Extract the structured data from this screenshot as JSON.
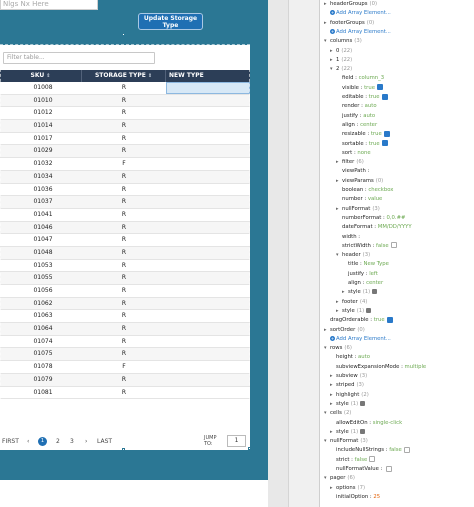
{
  "canvas": {
    "top_search_placeholder": "Nlgs Nx Here",
    "update_button_label": "Update Storage Type",
    "filter_placeholder": "Filter table...",
    "columns": [
      "SKU",
      "STORAGE TYPE",
      "NEW TYPE"
    ],
    "rows": [
      {
        "sku": "01008",
        "storage": "R"
      },
      {
        "sku": "01010",
        "storage": "R"
      },
      {
        "sku": "01012",
        "storage": "R"
      },
      {
        "sku": "01014",
        "storage": "R"
      },
      {
        "sku": "01017",
        "storage": "R"
      },
      {
        "sku": "01029",
        "storage": "R"
      },
      {
        "sku": "01032",
        "storage": "F"
      },
      {
        "sku": "01034",
        "storage": "R"
      },
      {
        "sku": "01036",
        "storage": "R"
      },
      {
        "sku": "01037",
        "storage": "R"
      },
      {
        "sku": "01041",
        "storage": "R"
      },
      {
        "sku": "01046",
        "storage": "R"
      },
      {
        "sku": "01047",
        "storage": "R"
      },
      {
        "sku": "01048",
        "storage": "R"
      },
      {
        "sku": "01053",
        "storage": "R"
      },
      {
        "sku": "01055",
        "storage": "R"
      },
      {
        "sku": "01056",
        "storage": "R"
      },
      {
        "sku": "01062",
        "storage": "R"
      },
      {
        "sku": "01063",
        "storage": "R"
      },
      {
        "sku": "01064",
        "storage": "R"
      },
      {
        "sku": "01074",
        "storage": "R"
      },
      {
        "sku": "01075",
        "storage": "R"
      },
      {
        "sku": "01078",
        "storage": "F"
      },
      {
        "sku": "01079",
        "storage": "R"
      },
      {
        "sku": "01081",
        "storage": "R"
      }
    ],
    "pager": {
      "first": "FIRST",
      "prev": "‹",
      "pages": [
        "1",
        "2",
        "3"
      ],
      "next": "›",
      "last": "LAST",
      "jump_label": "JUMP TO:",
      "jump_value": "1"
    }
  },
  "props": {
    "add_array_label": "Add Array Element...",
    "items": [
      {
        "indent": 1,
        "caret": "▸",
        "key": "headerGroups",
        "badge": "(0)"
      },
      {
        "indent": 2,
        "type": "add"
      },
      {
        "indent": 1,
        "caret": "▸",
        "key": "footerGroups",
        "badge": "(0)"
      },
      {
        "indent": 2,
        "type": "add"
      },
      {
        "indent": 1,
        "caret": "▾",
        "key": "columns",
        "badge": "(3)"
      },
      {
        "indent": 2,
        "caret": "▸",
        "key": "0",
        "badge": "(22)"
      },
      {
        "indent": 2,
        "caret": "▸",
        "key": "1",
        "badge": "(22)"
      },
      {
        "indent": 2,
        "caret": "▾",
        "key": "2",
        "badge": "(22)"
      },
      {
        "indent": 3,
        "key": "field",
        "value": "column_3",
        "vtype": "str"
      },
      {
        "indent": 3,
        "key": "visible",
        "value": "true",
        "vtype": "bool",
        "check": true
      },
      {
        "indent": 3,
        "key": "editable",
        "value": "true",
        "vtype": "bool",
        "check": true
      },
      {
        "indent": 3,
        "key": "render",
        "value": "auto",
        "vtype": "str"
      },
      {
        "indent": 3,
        "key": "justify",
        "value": "auto",
        "vtype": "str"
      },
      {
        "indent": 3,
        "key": "align",
        "value": "center",
        "vtype": "str"
      },
      {
        "indent": 3,
        "key": "resizable",
        "value": "true",
        "vtype": "bool",
        "check": true
      },
      {
        "indent": 3,
        "key": "sortable",
        "value": "true",
        "vtype": "bool",
        "check": true
      },
      {
        "indent": 3,
        "key": "sort",
        "value": "none",
        "vtype": "str"
      },
      {
        "indent": 3,
        "caret": "▸",
        "key": "filter",
        "badge": "(6)"
      },
      {
        "indent": 3,
        "key": "viewPath",
        "value": "",
        "vtype": "str"
      },
      {
        "indent": 3,
        "caret": "▸",
        "key": "viewParams",
        "badge": "(0)"
      },
      {
        "indent": 3,
        "key": "boolean",
        "value": "checkbox",
        "vtype": "str"
      },
      {
        "indent": 3,
        "key": "number",
        "value": "value",
        "vtype": "str"
      },
      {
        "indent": 3,
        "caret": "▸",
        "key": "nullFormat",
        "badge": "(3)"
      },
      {
        "indent": 3,
        "key": "numberFormat",
        "value": "0,0.##",
        "vtype": "str"
      },
      {
        "indent": 3,
        "key": "dateFormat",
        "value": "MM/DD/YYYY",
        "vtype": "str"
      },
      {
        "indent": 3,
        "key": "width",
        "value": "",
        "vtype": "str"
      },
      {
        "indent": 3,
        "key": "strictWidth",
        "value": "false",
        "vtype": "bool",
        "check": false
      },
      {
        "indent": 3,
        "caret": "▾",
        "key": "header",
        "badge": "(3)"
      },
      {
        "indent": 4,
        "key": "title",
        "value": "New Type",
        "vtype": "str"
      },
      {
        "indent": 4,
        "key": "justify",
        "value": "left",
        "vtype": "str"
      },
      {
        "indent": 4,
        "key": "align",
        "value": "center",
        "vtype": "str"
      },
      {
        "indent": 4,
        "caret": "▸",
        "key": "style",
        "badge": "(1)",
        "bind": true
      },
      {
        "indent": 3,
        "caret": "▸",
        "key": "footer",
        "badge": "(4)"
      },
      {
        "indent": 3,
        "caret": "▸",
        "key": "style",
        "badge": "(1)",
        "bind": true
      },
      {
        "indent": 1,
        "key": "dragOrderable",
        "value": "true",
        "vtype": "bool",
        "check": true
      },
      {
        "indent": 1,
        "caret": "▸",
        "key": "sortOrder",
        "badge": "(0)"
      },
      {
        "indent": 2,
        "type": "add"
      },
      {
        "indent": 1,
        "caret": "▾",
        "key": "rows",
        "badge": "(6)"
      },
      {
        "indent": 2,
        "key": "height",
        "value": "auto",
        "vtype": "str"
      },
      {
        "indent": 2,
        "key": "subviewExpansionMode",
        "value": "multiple",
        "vtype": "str"
      },
      {
        "indent": 2,
        "caret": "▸",
        "key": "subview",
        "badge": "(3)"
      },
      {
        "indent": 2,
        "caret": "▸",
        "key": "striped",
        "badge": "(3)"
      },
      {
        "indent": 2,
        "caret": "▸",
        "key": "highlight",
        "badge": "(2)"
      },
      {
        "indent": 2,
        "caret": "▸",
        "key": "style",
        "badge": "(1)",
        "bind": true
      },
      {
        "indent": 1,
        "caret": "▾",
        "key": "cells",
        "badge": "(2)"
      },
      {
        "indent": 2,
        "key": "allowEditOn",
        "value": "single-click",
        "vtype": "str"
      },
      {
        "indent": 2,
        "caret": "▸",
        "key": "style",
        "badge": "(1)",
        "bind": true
      },
      {
        "indent": 1,
        "caret": "▾",
        "key": "nullFormat",
        "badge": "(3)"
      },
      {
        "indent": 2,
        "key": "includeNullStrings",
        "value": "false",
        "vtype": "bool",
        "check": false
      },
      {
        "indent": 2,
        "key": "strict",
        "value": "false",
        "vtype": "bool",
        "check": false
      },
      {
        "indent": 2,
        "key": "nullFormatValue",
        "value": "",
        "vtype": "str",
        "check": false
      },
      {
        "indent": 1,
        "caret": "▾",
        "key": "pager",
        "badge": "(6)"
      },
      {
        "indent": 2,
        "caret": "▸",
        "key": "options",
        "badge": "(7)"
      },
      {
        "indent": 2,
        "key": "initialOption",
        "value": "25",
        "vtype": "num"
      }
    ]
  }
}
